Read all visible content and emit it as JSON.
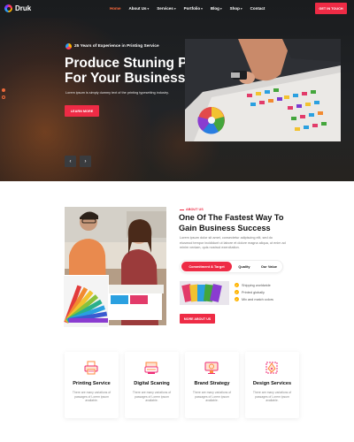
{
  "nav": {
    "logo": "Druk",
    "items": [
      {
        "label": "Home",
        "caret": ""
      },
      {
        "label": "About Us",
        "caret": "▾"
      },
      {
        "label": "Services",
        "caret": "▾"
      },
      {
        "label": "Portfolio",
        "caret": "▾"
      },
      {
        "label": "Blog",
        "caret": "▾"
      },
      {
        "label": "Shop",
        "caret": "▾"
      },
      {
        "label": "Contact",
        "caret": ""
      }
    ],
    "cta": "GET IN TOUCH",
    "active_color": "#ff6b3d"
  },
  "hero": {
    "badge": "25 Years of Experience in Printing Service",
    "title_line1": "Produce Stuning Printing",
    "title_line2": "For Your Business.",
    "description": "Lorem ipsum is simply dummy text of the printing typesetting industry.",
    "button": "LEARN MORE",
    "prev_arrow": "‹",
    "next_arrow": "›"
  },
  "about": {
    "label": "ABOUT US",
    "title_line1": "One Of The Fastest Way To",
    "title_line2": "Gain Business Success",
    "description": "Lorem ipsum dolor sit amet, consectetur adipiscing elit, sed do eiusmod tempor incididunt ut labore et dolore magna aliqua, ut enim ad minim veniam, quis nostrud exercitation.",
    "tabs": [
      "Commitment & Target",
      "Quality",
      "Our Value"
    ],
    "bullets": [
      "Shipping worldwide",
      "Printed globally",
      "Mix and match colors"
    ],
    "button": "MORE ABOUT US"
  },
  "services": [
    {
      "title": "Printing Service",
      "desc": "There are many variations of passages of Lorem ipsum available.",
      "icon": "printer-icon"
    },
    {
      "title": "Digital Scaning",
      "desc": "There are many variations of passages of Lorem ipsum available.",
      "icon": "scanner-icon"
    },
    {
      "title": "Brand Strategy",
      "desc": "There are many variations of passages of Lorem ipsum available.",
      "icon": "monitor-icon"
    },
    {
      "title": "Design Services",
      "desc": "There are many variations of passages of Lorem ipsum available.",
      "icon": "pen-tool-icon"
    }
  ],
  "colors": {
    "accent": "#ee2b45",
    "hero_bg": "#1d1f22",
    "icon_orange": "#ff8a3d",
    "icon_pink": "#ee2b75"
  }
}
